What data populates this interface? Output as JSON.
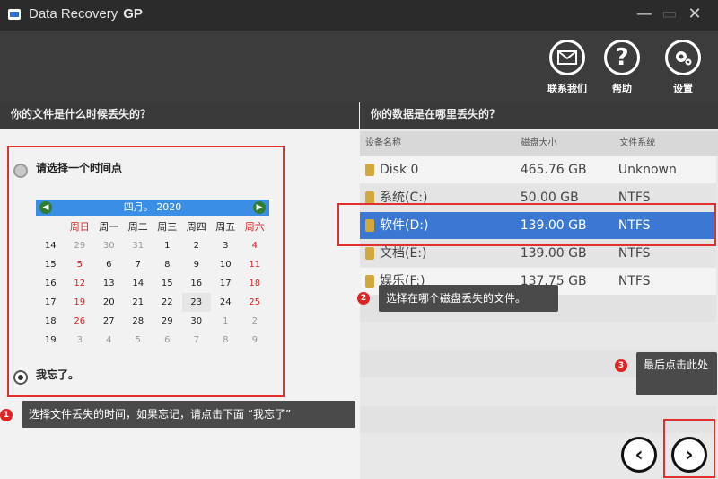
{
  "app": {
    "title": "Data Recovery",
    "title_suffix": "GP"
  },
  "window": {
    "minimize": "—",
    "maximize": "▭",
    "close": "✕"
  },
  "toolbar": {
    "contact_label": "联系我们",
    "help_label": "帮助",
    "settings_label": "设置"
  },
  "left": {
    "header": "你的文件是什么时候丢失的？",
    "option_select": "请选择一个时间点",
    "option_forgot": "我忘了。",
    "calendar": {
      "month_label": "四月。 2020",
      "weekdays": [
        "周日",
        "周一",
        "周二",
        "周三",
        "周四",
        "周五",
        "周六"
      ],
      "weeks": [
        {
          "wk": "14",
          "days": [
            "29",
            "30",
            "31",
            "1",
            "2",
            "3",
            "4"
          ]
        },
        {
          "wk": "15",
          "days": [
            "5",
            "6",
            "7",
            "8",
            "9",
            "10",
            "11"
          ]
        },
        {
          "wk": "16",
          "days": [
            "12",
            "13",
            "14",
            "15",
            "16",
            "17",
            "18"
          ]
        },
        {
          "wk": "17",
          "days": [
            "19",
            "20",
            "21",
            "22",
            "23",
            "24",
            "25"
          ]
        },
        {
          "wk": "18",
          "days": [
            "26",
            "27",
            "28",
            "29",
            "30",
            "1",
            "2"
          ]
        },
        {
          "wk": "19",
          "days": [
            "3",
            "4",
            "5",
            "6",
            "7",
            "8",
            "9"
          ]
        }
      ]
    },
    "tip1": {
      "num": "1",
      "text": "选择文件丢失的时间，如果忘记，请点击下面 “我忘了”"
    }
  },
  "right": {
    "header": "你的数据是在哪里丢失的？",
    "columns": [
      "设备名称",
      "磁盘大小",
      "文件系统"
    ],
    "drives": [
      {
        "name": "Disk 0",
        "size": "465.76 GB",
        "fs": "Unknown"
      },
      {
        "name": "系统(C:)",
        "size": "50.00 GB",
        "fs": "NTFS"
      },
      {
        "name": "软件(D:)",
        "size": "139.00 GB",
        "fs": "NTFS"
      },
      {
        "name": "文档(E:)",
        "size": "139.00 GB",
        "fs": "NTFS"
      },
      {
        "name": "娱乐(F:)",
        "size": "137.75 GB",
        "fs": "NTFS"
      }
    ],
    "tip2": {
      "num": "2",
      "text": "选择在哪个磁盘丢失的文件。"
    },
    "tip3": {
      "num": "3",
      "text": "最后点击此处"
    }
  },
  "nav": {
    "back": "‹",
    "next": "›"
  },
  "colors": {
    "accent": "#3a78d4",
    "highlight_red": "#e03030",
    "titlebar": "#2b2b2b"
  }
}
